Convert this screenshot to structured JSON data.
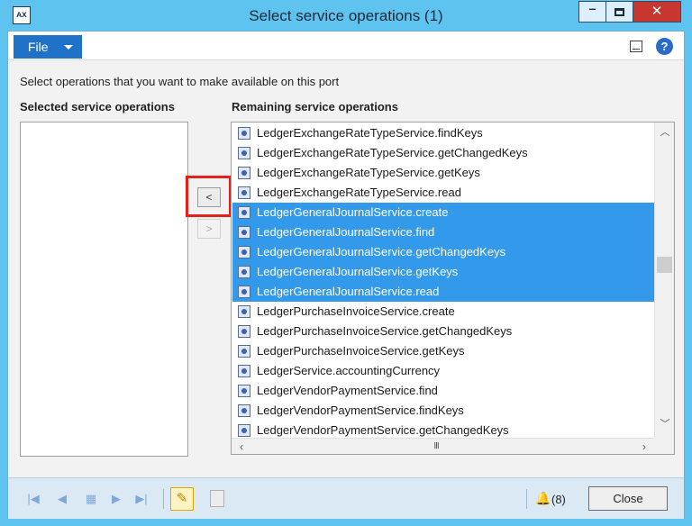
{
  "window": {
    "title": "Select service operations (1)",
    "minimize": "–",
    "close": "✕"
  },
  "menubar": {
    "file_label": "File",
    "help_label": "?"
  },
  "instruction": "Select operations that you want to make available on this port",
  "selected_panel": {
    "header": "Selected service operations",
    "items": []
  },
  "buttons": {
    "add": "<",
    "remove": ">"
  },
  "remaining_panel": {
    "header": "Remaining service operations",
    "items": [
      {
        "label": "LedgerExchangeRateTypeService.findKeys",
        "selected": false
      },
      {
        "label": "LedgerExchangeRateTypeService.getChangedKeys",
        "selected": false
      },
      {
        "label": "LedgerExchangeRateTypeService.getKeys",
        "selected": false
      },
      {
        "label": "LedgerExchangeRateTypeService.read",
        "selected": false
      },
      {
        "label": "LedgerGeneralJournalService.create",
        "selected": true
      },
      {
        "label": "LedgerGeneralJournalService.find",
        "selected": true
      },
      {
        "label": "LedgerGeneralJournalService.getChangedKeys",
        "selected": true
      },
      {
        "label": "LedgerGeneralJournalService.getKeys",
        "selected": true
      },
      {
        "label": "LedgerGeneralJournalService.read",
        "selected": true
      },
      {
        "label": "LedgerPurchaseInvoiceService.create",
        "selected": false
      },
      {
        "label": "LedgerPurchaseInvoiceService.getChangedKeys",
        "selected": false
      },
      {
        "label": "LedgerPurchaseInvoiceService.getKeys",
        "selected": false
      },
      {
        "label": "LedgerService.accountingCurrency",
        "selected": false
      },
      {
        "label": "LedgerVendorPaymentService.find",
        "selected": false
      },
      {
        "label": "LedgerVendorPaymentService.findKeys",
        "selected": false
      },
      {
        "label": "LedgerVendorPaymentService.getChangedKeys",
        "selected": false
      }
    ],
    "scroll_grip": "III"
  },
  "toolbar": {
    "first": "|◀",
    "prev": "◀",
    "list": "▦",
    "next": "▶",
    "last": "▶|",
    "edit": "✎",
    "notifications": "(8)",
    "close_label": "Close"
  },
  "colors": {
    "frame": "#5ec3ee",
    "selection": "#3399ea",
    "file_button": "#1f72c8",
    "highlight": "#e3201b",
    "close_button": "#c7372f"
  },
  "icons": {
    "app": "app-icon",
    "service_operation": "service-operation-icon",
    "help": "help-icon",
    "bell": "notification-bell-icon"
  }
}
